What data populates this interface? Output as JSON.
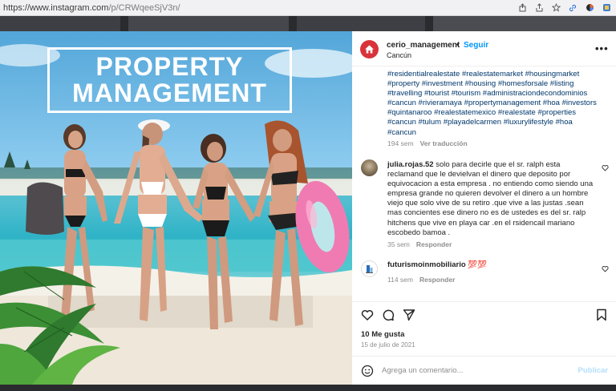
{
  "browser": {
    "url_main": "https://www.instagram.com",
    "url_path": "/p/CRWqeeSjV3n/"
  },
  "image": {
    "title_line1": "PROPERTY",
    "title_line2": "MANAGEMENT"
  },
  "post": {
    "username": "cerio_management",
    "separator": "•",
    "follow_label": "Seguir",
    "location": "Cancún",
    "more": "•••",
    "caption": "#residentialrealestate #realestatemarket #housingmarket #property #investment #housing #homesforsale #listing #travelling #tourist #tourism #administraciondecondominios #cancun #rivieramaya #propertymanagement #hoa #investors #quintanaroo #realestatemexico #realestate #properties #cancun #tulum #playadelcarmen #luxurylifestyle #hoa #cancun",
    "caption_age": "194 sem",
    "see_translation": "Ver traducción"
  },
  "comments": [
    {
      "username": "julia.rojas.52",
      "text": "solo para decirle que el sr. ralph esta reclamand que le devielvan el dinero que deposito por equivocacion a esta empresa . no entiendo como siendo una empresa grande no quieren devolver el dinero a un hombre viejo que solo vive de su retiro .que vive a las justas .sean mas concientes ese dinero no es de ustedes es del sr. ralp hitchens que vive en playa car .en el rsidencail mariano escobedo bamoa .",
      "age": "35 sem",
      "reply": "Responder"
    },
    {
      "username": "futurismoinmobiliario",
      "text": "💯💯",
      "age": "114 sem",
      "reply": "Responder"
    }
  ],
  "actions": {
    "likes": "10 Me gusta",
    "date": "15 de julio de 2021",
    "comment_placeholder": "Agrega un comentario...",
    "post_label": "Publicar"
  },
  "colors": {
    "link": "#00376b",
    "follow": "#0095f6",
    "brand": "#d8333b",
    "muted": "#8e8e8e"
  }
}
